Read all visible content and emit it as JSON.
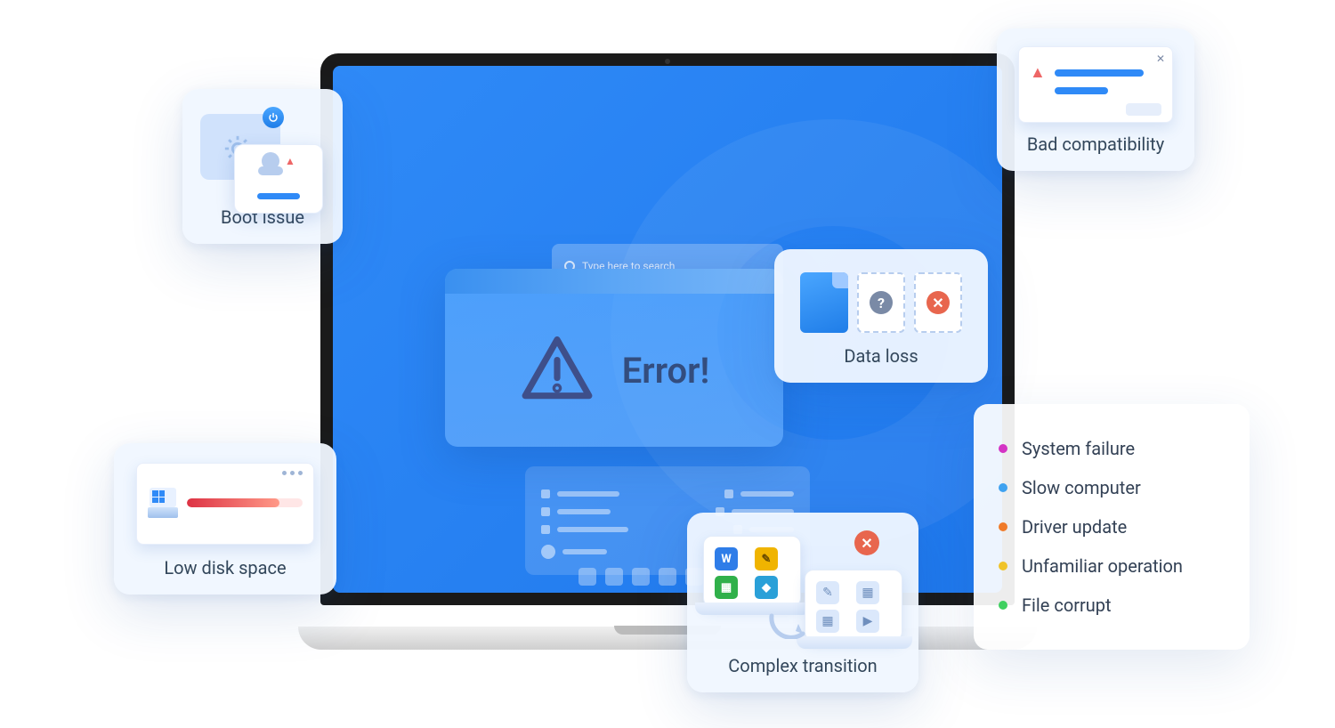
{
  "desktop": {
    "search_placeholder": "Type here to search"
  },
  "error_banner": {
    "title": "Error!"
  },
  "cards": {
    "boot": {
      "label": "Boot issue"
    },
    "low_disk": {
      "label": "Low disk space"
    },
    "data_loss": {
      "label": "Data loss"
    },
    "compat": {
      "label": "Bad compatibility"
    },
    "transition": {
      "label": "Complex transition"
    }
  },
  "legend": {
    "items": [
      {
        "label": "System failure",
        "color": "#d433c4"
      },
      {
        "label": "Slow computer",
        "color": "#3fa2f0"
      },
      {
        "label": "Driver update",
        "color": "#f07a28"
      },
      {
        "label": "Unfamiliar operation",
        "color": "#f0c328"
      },
      {
        "label": "File corrupt",
        "color": "#3fd060"
      }
    ]
  }
}
